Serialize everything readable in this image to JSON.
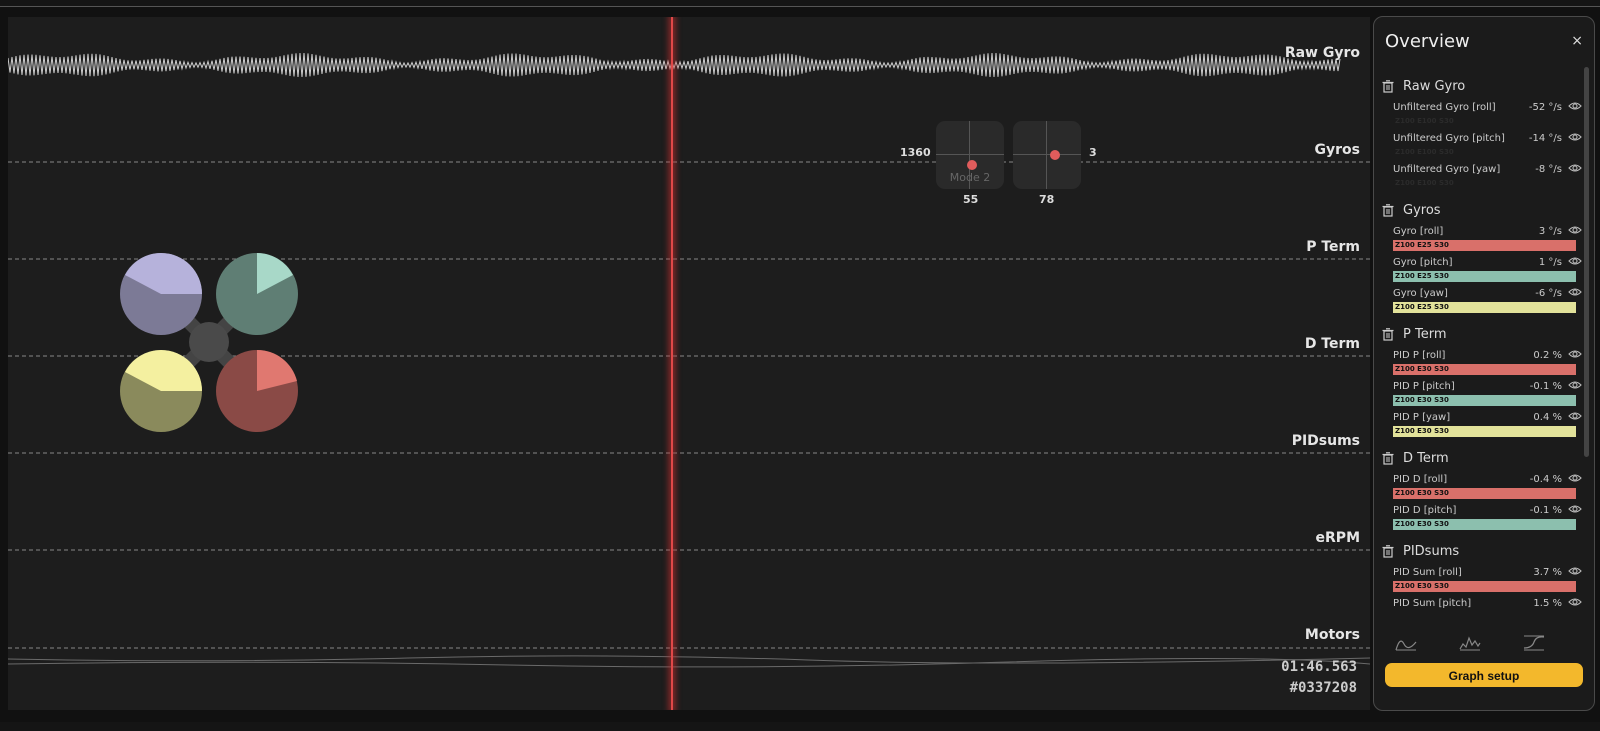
{
  "graph": {
    "lanes": [
      {
        "label": "Raw Gyro"
      },
      {
        "label": "Gyros"
      },
      {
        "label": "P Term"
      },
      {
        "label": "D Term"
      },
      {
        "label": "PIDsums"
      },
      {
        "label": "eRPM"
      },
      {
        "label": "Motors"
      }
    ],
    "sticks": {
      "left_top_value": "1360",
      "left_bottom_value": "55",
      "right_bottom_value": "78",
      "right_side_value": "3",
      "mode_label": "Mode 2"
    },
    "time": "01:46.563",
    "frame": "#0337208"
  },
  "overview": {
    "title": "Overview",
    "close_icon": "×",
    "sections": [
      {
        "name": "Raw Gyro",
        "items": [
          {
            "label": "Unfiltered Gyro [roll]",
            "value": "-52 °/s",
            "tag": "Z100 E100 S30",
            "color": ""
          },
          {
            "label": "Unfiltered Gyro [pitch]",
            "value": "-14 °/s",
            "tag": "Z100 E100 S30",
            "color": ""
          },
          {
            "label": "Unfiltered Gyro [yaw]",
            "value": "-8 °/s",
            "tag": "Z100 E100 S30",
            "color": ""
          }
        ]
      },
      {
        "name": "Gyros",
        "items": [
          {
            "label": "Gyro [roll]",
            "value": "3 °/s",
            "tag": "Z100 E25 S30",
            "color": "#d9706a"
          },
          {
            "label": "Gyro [pitch]",
            "value": "1 °/s",
            "tag": "Z100 E25 S30",
            "color": "#8cbfae"
          },
          {
            "label": "Gyro [yaw]",
            "value": "-6 °/s",
            "tag": "Z100 E25 S30",
            "color": "#e2e29a"
          }
        ]
      },
      {
        "name": "P Term",
        "items": [
          {
            "label": "PID P [roll]",
            "value": "0.2 %",
            "tag": "Z100 E30 S30",
            "color": "#d9706a"
          },
          {
            "label": "PID P [pitch]",
            "value": "-0.1 %",
            "tag": "Z100 E30 S30",
            "color": "#8cbfae"
          },
          {
            "label": "PID P [yaw]",
            "value": "0.4 %",
            "tag": "Z100 E30 S30",
            "color": "#e2e29a"
          }
        ]
      },
      {
        "name": "D Term",
        "items": [
          {
            "label": "PID D [roll]",
            "value": "-0.4 %",
            "tag": "Z100 E30 S30",
            "color": "#d9706a"
          },
          {
            "label": "PID D [pitch]",
            "value": "-0.1 %",
            "tag": "Z100 E30 S30",
            "color": "#8cbfae"
          }
        ]
      },
      {
        "name": "PIDsums",
        "items": [
          {
            "label": "PID Sum [roll]",
            "value": "3.7 %",
            "tag": "Z100 E30 S30",
            "color": "#d9706a"
          },
          {
            "label": "PID Sum [pitch]",
            "value": "1.5 %",
            "tag": "",
            "color": ""
          }
        ]
      }
    ],
    "bottom_icons": [
      "step-response-icon",
      "spectrum-icon",
      "curve-icon"
    ],
    "graph_setup_label": "Graph setup"
  },
  "colors": {
    "accent": "#f3b82c",
    "cursor": "#e04848",
    "roll": "#d9706a",
    "pitch": "#8cbfae",
    "yaw": "#e2e29a",
    "motor_1": "#b6b2db",
    "motor_2": "#a8d8c8",
    "motor_3": "#f4f0a0",
    "motor_4": "#e07870"
  }
}
